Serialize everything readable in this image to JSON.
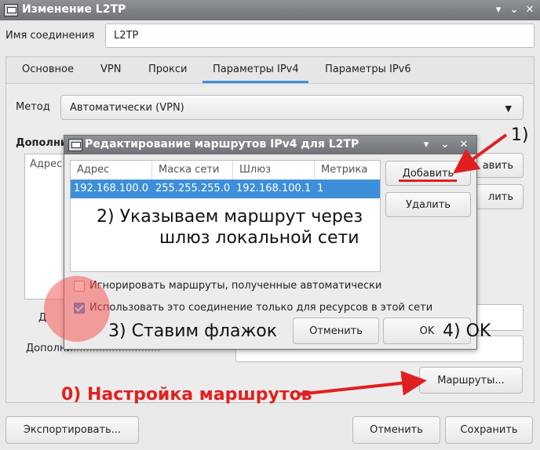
{
  "window": {
    "title": "Изменение L2TP",
    "connection_name_label": "Имя соединения",
    "connection_name_value": "L2TP"
  },
  "tabs": [
    {
      "label": "Основное"
    },
    {
      "label": "VPN"
    },
    {
      "label": "Прокси"
    },
    {
      "label": "Параметры IPv4",
      "active": true
    },
    {
      "label": "Параметры IPv6"
    }
  ],
  "ipv4": {
    "method_label": "Метод",
    "method_value": "Автоматически (VPN)",
    "extra_label_partial": "Дополни",
    "extra_label2_partial": "Дополни",
    "extra_label2_tail": "...........................",
    "list_header_partial": "Адрес",
    "add_partial": "авить",
    "delete_partial": "лить",
    "small_label_partial": "Д",
    "routes_button": "Маршруты..."
  },
  "footer": {
    "export_button": "Экспортировать...",
    "cancel_button": "Отменить",
    "save_button": "Сохранить"
  },
  "dialog": {
    "title": "Редактирование маршрутов IPv4 для L2TP",
    "columns": [
      "Адрес",
      "Маска сети",
      "Шлюз",
      "Метрика"
    ],
    "rows": [
      {
        "address": "192.168.100.0",
        "netmask": "255.255.255.0",
        "gateway": "192.168.100.1",
        "metric": "1"
      }
    ],
    "add_button": "Добавить",
    "delete_button": "Удалить",
    "ignore_auto_routes_label": "Игнорировать маршруты, полученные автоматически",
    "ignore_auto_routes_checked": false,
    "use_only_for_resources_label": "Использовать это соединение только для ресурсов в этой сети",
    "use_only_for_resources_checked": true,
    "cancel_button": "Отменить",
    "ok_button": "OK"
  },
  "annotations": {
    "step0": "0) Настройка маршрутов",
    "step1": "1)",
    "step2_line1": "2) Указываем маршрут через",
    "step2_line2": "шлюз локальной сети",
    "step3": "3) Ставим флажок",
    "step4": "4) OK"
  },
  "colors": {
    "selection": "#3d8fd9",
    "annotation_red": "#e02020",
    "titlebar": "#7d8084"
  }
}
